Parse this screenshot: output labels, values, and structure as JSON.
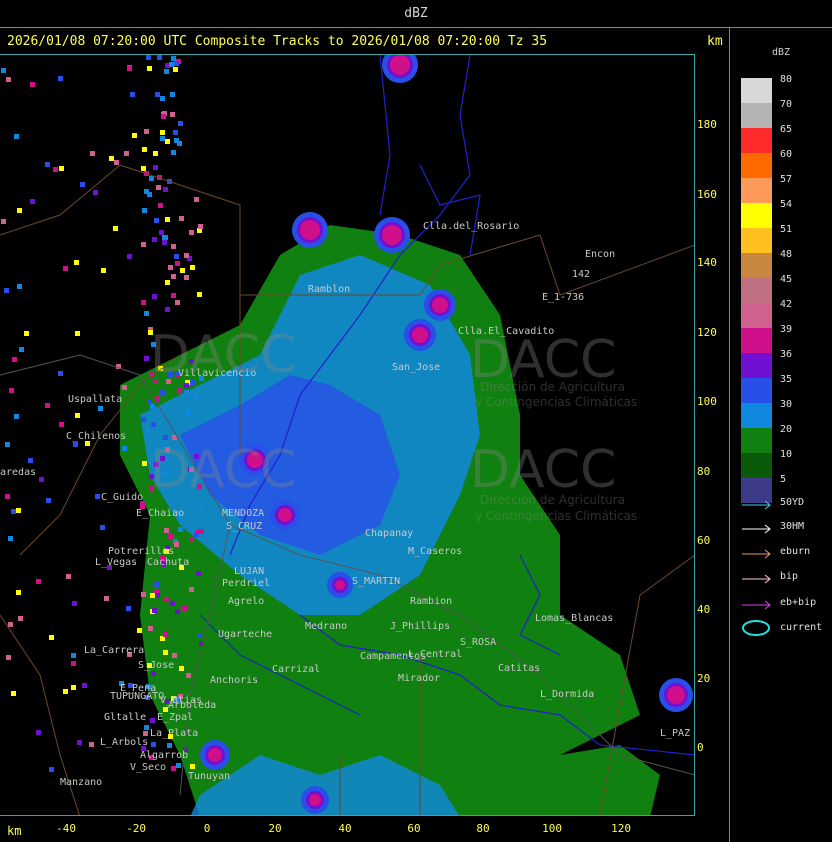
{
  "window_title": "dBZ",
  "header": "2026/01/08 07:20:00 UTC Composite Tracks to 2026/01/08 07:20:00 Tz 35",
  "axis_unit": "km",
  "y_ticks": [
    "180",
    "160",
    "140",
    "120",
    "100",
    "80",
    "60",
    "40",
    "20",
    "0"
  ],
  "x_ticks": [
    "-40",
    "-20",
    "0",
    "20",
    "40",
    "60",
    "80",
    "100",
    "120"
  ],
  "legend": {
    "title": "dBZ",
    "levels": [
      {
        "label": "80",
        "color": "#d8d8d8"
      },
      {
        "label": "70",
        "color": "#b4b4b4"
      },
      {
        "label": "65",
        "color": "#ff2a2a"
      },
      {
        "label": "60",
        "color": "#ff6a00"
      },
      {
        "label": "57",
        "color": "#ff9a5a"
      },
      {
        "label": "54",
        "color": "#ffff00"
      },
      {
        "label": "51",
        "color": "#ffc020"
      },
      {
        "label": "48",
        "color": "#c8863e"
      },
      {
        "label": "45",
        "color": "#c07080"
      },
      {
        "label": "42",
        "color": "#d0608e"
      },
      {
        "label": "39",
        "color": "#d0108a"
      },
      {
        "label": "36",
        "color": "#7010d0"
      },
      {
        "label": "35",
        "color": "#2850e8"
      },
      {
        "label": "30",
        "color": "#1088e0"
      },
      {
        "label": "20",
        "color": "#108010"
      },
      {
        "label": "10",
        "color": "#0a5a0a"
      },
      {
        "label": "5",
        "color": "#3e3a8a"
      }
    ],
    "tracks": [
      {
        "label": "50YD",
        "color": "#40d0e0"
      },
      {
        "label": "30HM",
        "color": "#ffffff"
      },
      {
        "label": "eburn",
        "color": "#e0a060"
      },
      {
        "label": "bip",
        "color": "#ffc8d8"
      },
      {
        "label": "eb+bip",
        "color": "#e040e0"
      },
      {
        "label": "current",
        "color": "#20e0e0"
      }
    ]
  },
  "watermark": {
    "brand": "DACC",
    "line1": "Dirección de Agricultura",
    "line2": "y Contingencias Climáticas"
  },
  "places": [
    {
      "name": "Clla.del_Rosario"
    },
    {
      "name": "Encon"
    },
    {
      "name": "142"
    },
    {
      "name": "E_1-736"
    },
    {
      "name": "Ramblon"
    },
    {
      "name": "Clla.El_Cavadito"
    },
    {
      "name": "San_Jose"
    },
    {
      "name": "Villavicencio"
    },
    {
      "name": "Uspallata"
    },
    {
      "name": "C_Chilenos"
    },
    {
      "name": "aredas"
    },
    {
      "name": "C_Guido"
    },
    {
      "name": "E_Chaiao"
    },
    {
      "name": "MENDOZA"
    },
    {
      "name": "S_CRUZ"
    },
    {
      "name": "Potrerillos"
    },
    {
      "name": "L_Vegas"
    },
    {
      "name": "Cachuta"
    },
    {
      "name": "LUJAN"
    },
    {
      "name": "Perdriel"
    },
    {
      "name": "Agrelo"
    },
    {
      "name": "S_MARTIN"
    },
    {
      "name": "Rambion"
    },
    {
      "name": "M_Caseros"
    },
    {
      "name": "Chapanay"
    },
    {
      "name": "Ugarteche"
    },
    {
      "name": "La_Carrera"
    },
    {
      "name": "S_Jose"
    },
    {
      "name": "Carrizal"
    },
    {
      "name": "Anchoris"
    },
    {
      "name": "E_Pena"
    },
    {
      "name": "TUPUNGATO"
    },
    {
      "name": "V_Btias"
    },
    {
      "name": "Arboleda"
    },
    {
      "name": "Gltalle"
    },
    {
      "name": "E_Zpal"
    },
    {
      "name": "L_Arbols"
    },
    {
      "name": "La_Plata"
    },
    {
      "name": "Algarrob"
    },
    {
      "name": "V_Seco"
    },
    {
      "name": "Manzano"
    },
    {
      "name": "Tunuyan"
    },
    {
      "name": "Mirador"
    },
    {
      "name": "J_Phillips"
    },
    {
      "name": "L_Central"
    },
    {
      "name": "S_ROSA"
    },
    {
      "name": "Lomas_Blancas"
    },
    {
      "name": "Catitas"
    },
    {
      "name": "L_Dormida"
    },
    {
      "name": "L_PAZ"
    },
    {
      "name": "Medrano"
    },
    {
      "name": "Campamentos"
    }
  ]
}
